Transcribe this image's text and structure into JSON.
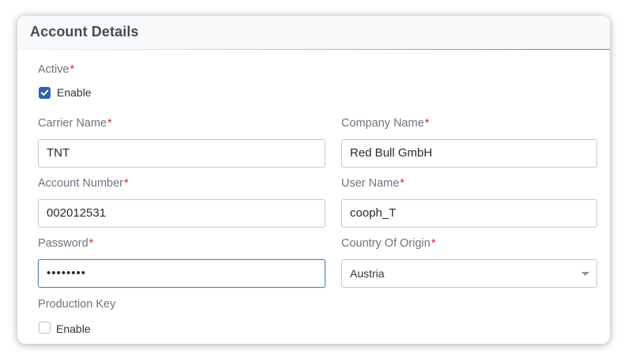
{
  "card": {
    "title": "Account Details"
  },
  "required_marker": "*",
  "active": {
    "label": "Active",
    "checkbox_label": "Enable",
    "checked": true
  },
  "carrier_name": {
    "label": "Carrier Name",
    "value": "TNT"
  },
  "company_name": {
    "label": "Company Name",
    "value": "Red Bull GmbH"
  },
  "account_number": {
    "label": "Account Number",
    "value": "002012531"
  },
  "user_name": {
    "label": "User Name",
    "value": "cooph_T"
  },
  "password": {
    "label": "Password",
    "value": "••••••••"
  },
  "country_of_origin": {
    "label": "Country Of Origin",
    "selected": "Austria"
  },
  "production_key": {
    "label": "Production Key",
    "checkbox_label": "Enable",
    "checked": false
  },
  "colors": {
    "accent": "#2d63b0",
    "required": "#d62b2b",
    "label": "#6b7580",
    "focus_border": "#4a7fbf"
  },
  "icons": {
    "checkmark": "check-icon",
    "dropdown": "chevron-down-icon"
  }
}
